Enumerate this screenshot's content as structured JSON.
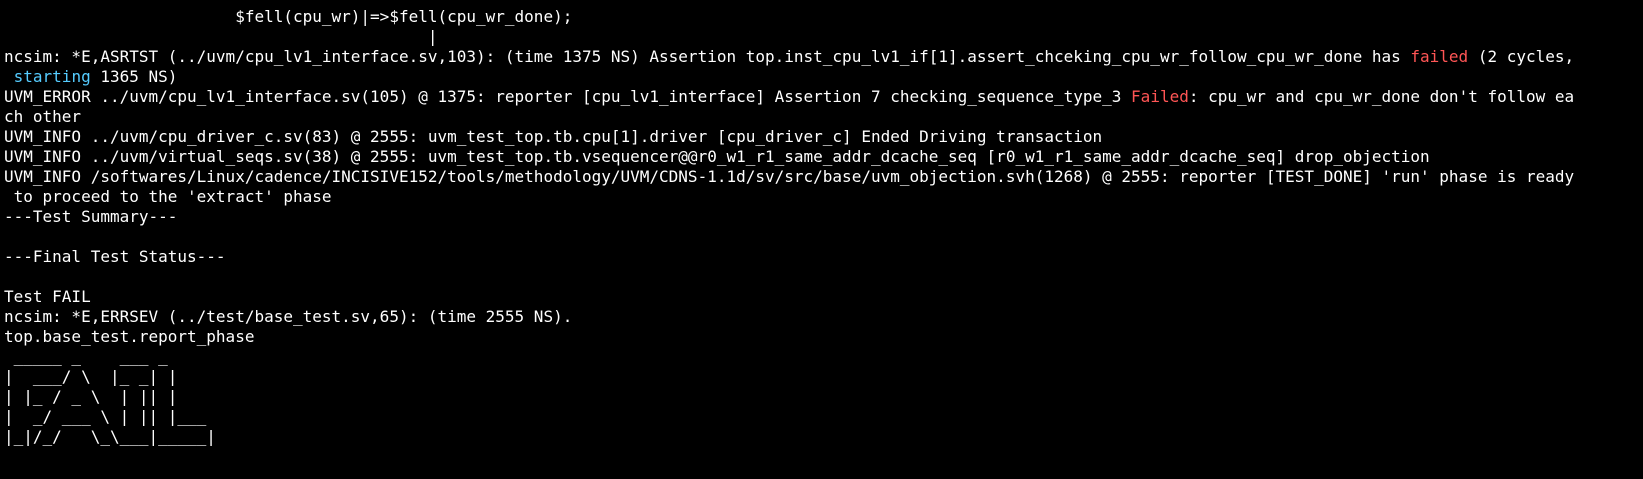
{
  "terminal": {
    "lines": [
      "                        $fell(cpu_wr)|=>$fell(cpu_wr_done);",
      "                                            |"
    ],
    "assert": {
      "l1_pre": "ncsim: *E,ASRTST (../uvm/cpu_lv1_interface.sv,103): (time 1375 NS) Assertion top.inst_cpu_lv1_if[1].assert_chceking_cpu_wr_follow_cpu_wr_done has ",
      "l1_failed": "failed",
      "l1_post": " (2 cycles,",
      "l2_pre": " ",
      "l2_starting": "starting",
      "l2_post": " 1365 NS)"
    },
    "uvm_error": {
      "l1_pre": "UVM_ERROR ../uvm/cpu_lv1_interface.sv(105) @ 1375: reporter [cpu_lv1_interface] Assertion 7 checking_sequence_type_3 ",
      "l1_failed": "Failed",
      "l1_post": ": cpu_wr and cpu_wr_done don't follow ea",
      "l2": "ch other"
    },
    "info_lines": [
      "UVM_INFO ../uvm/cpu_driver_c.sv(83) @ 2555: uvm_test_top.tb.cpu[1].driver [cpu_driver_c] Ended Driving transaction",
      "UVM_INFO ../uvm/virtual_seqs.sv(38) @ 2555: uvm_test_top.tb.vsequencer@@r0_w1_r1_same_addr_dcache_seq [r0_w1_r1_same_addr_dcache_seq] drop_objection",
      "UVM_INFO /softwares/Linux/cadence/INCISIVE152/tools/methodology/UVM/CDNS-1.1d/sv/src/base/uvm_objection.svh(1268) @ 2555: reporter [TEST_DONE] 'run' phase is ready",
      " to proceed to the 'extract' phase"
    ],
    "summary": {
      "test_summary": "---Test Summary---",
      "blank1": "",
      "final_status": "---Final Test Status---",
      "blank2": "",
      "test_fail": "Test FAIL",
      "errsev": "ncsim: *E,ERRSEV (../test/base_test.sv,65): (time 2555 NS).",
      "report_phase": "top.base_test.report_phase"
    },
    "banner": [
      " _____ _    ___ _",
      "|  ___/ \\  |_ _| |",
      "| |_ / _ \\  | || |",
      "|  _/ ___ \\ | || |___",
      "|_|/_/   \\_\\___|_____|"
    ]
  }
}
